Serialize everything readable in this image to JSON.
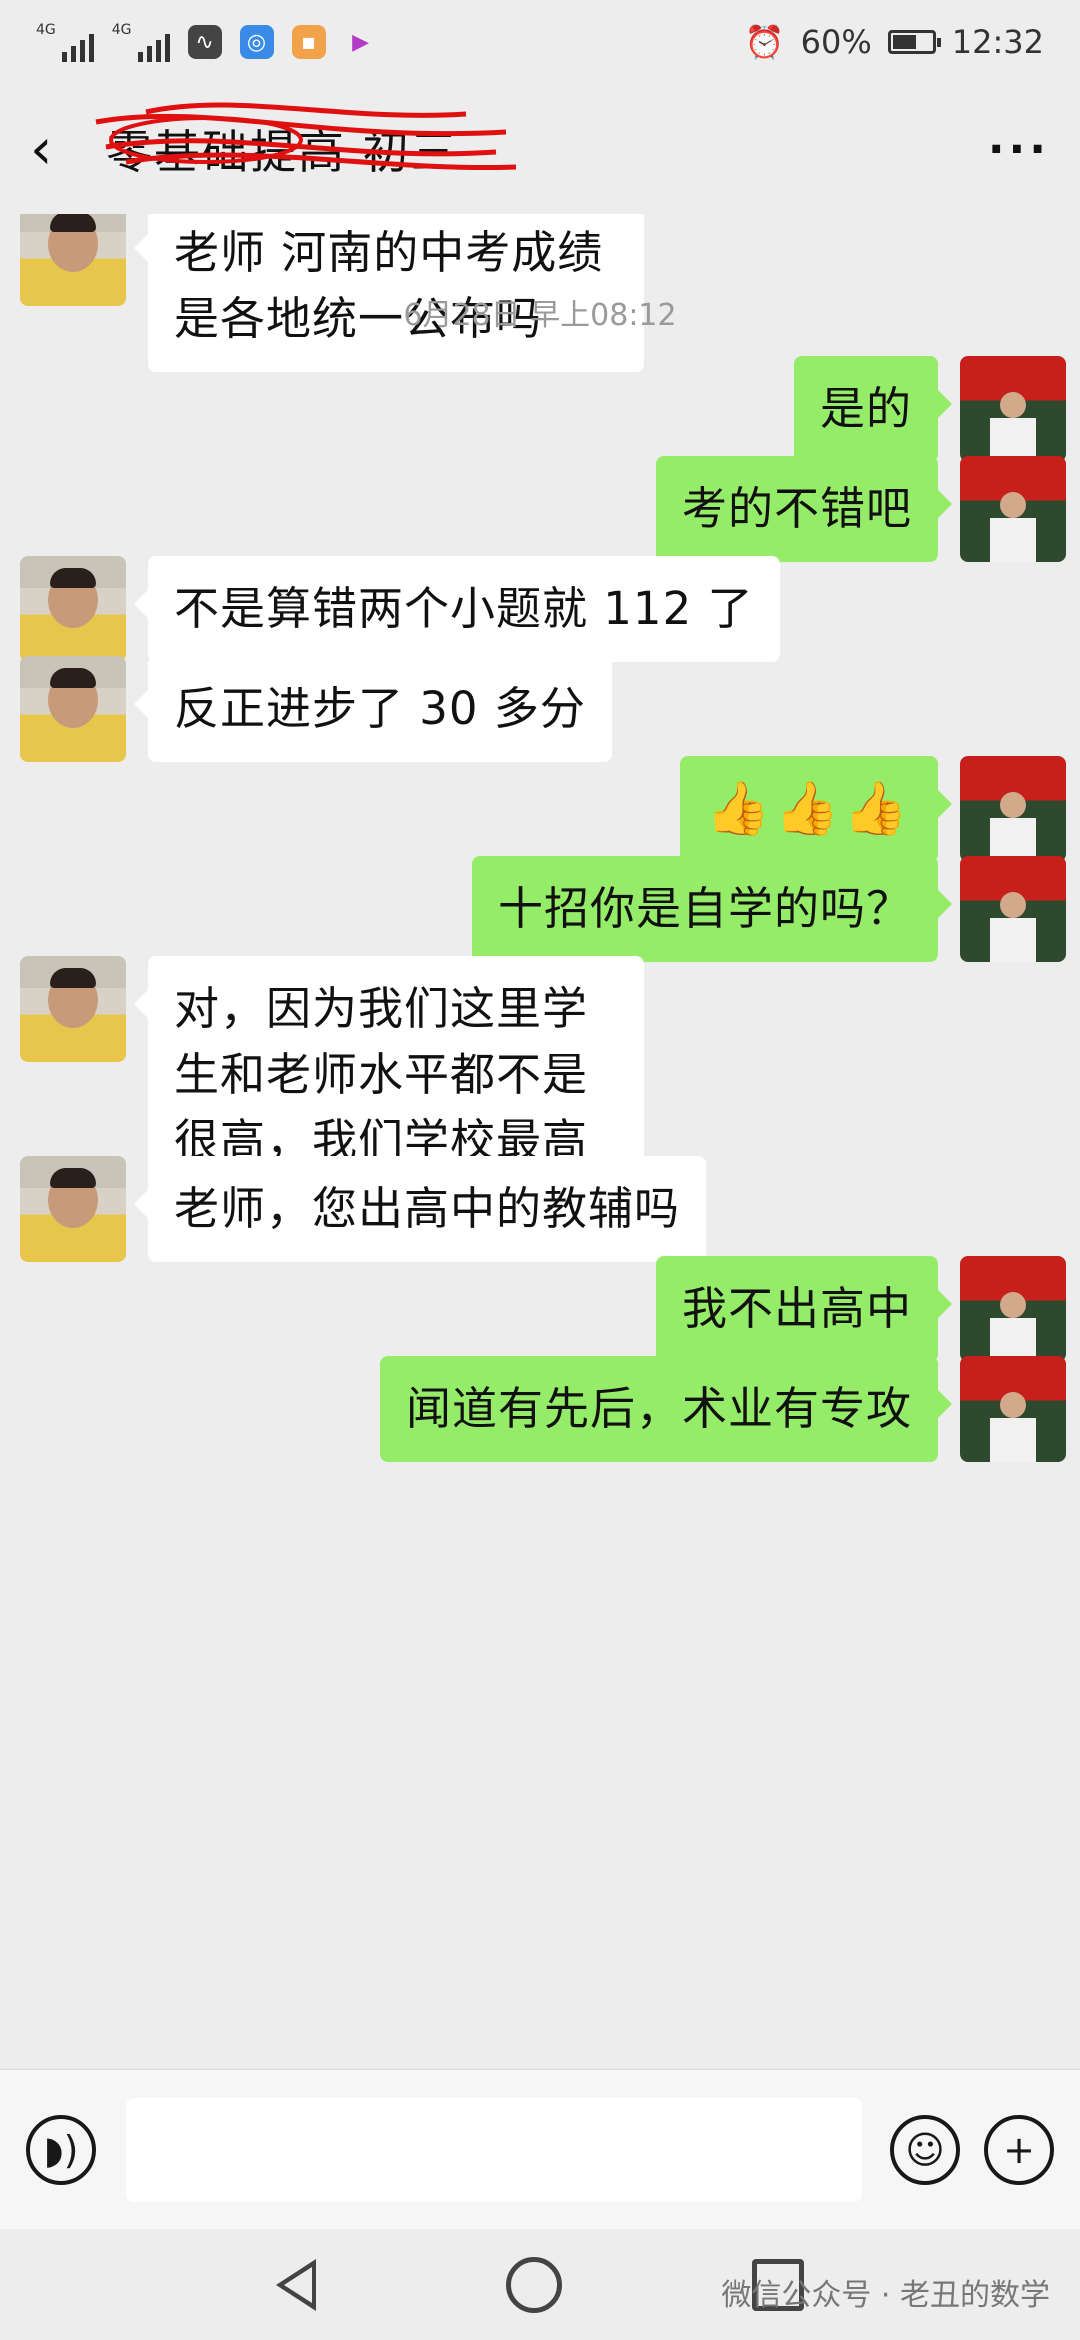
{
  "status_bar": {
    "network1": "4G",
    "network2": "4G",
    "battery_percent": "60%",
    "battery_level": 0.6,
    "time": "12:32",
    "icons": [
      "signal-icon",
      "activity-icon",
      "browser-icon",
      "app-icon",
      "video-icon",
      "alarm-icon",
      "battery-icon"
    ]
  },
  "header": {
    "back_glyph": "‹",
    "title": "零基础提高 初三",
    "more_glyph": "···"
  },
  "messages": [
    {
      "side": "left",
      "text": "老师 河南的中考成绩是各地统一公布吗"
    },
    {
      "side": "timestamp",
      "text": "6月28日 早上08:12"
    },
    {
      "side": "right",
      "text": "是的"
    },
    {
      "side": "right",
      "text": "考的不错吧"
    },
    {
      "side": "left",
      "text": "不是算错两个小题就 112 了"
    },
    {
      "side": "left",
      "text": "反正进步了 30 多分"
    },
    {
      "side": "right",
      "text": "👍👍👍"
    },
    {
      "side": "right",
      "text": "十招你是自学的吗？"
    },
    {
      "side": "left",
      "text": "对，因为我们这里学生和老师水平都不是很高，我们学校最高分才一百零几"
    },
    {
      "side": "left",
      "text": "老师，您出高中的教辅吗"
    },
    {
      "side": "right",
      "text": "我不出高中"
    },
    {
      "side": "right",
      "text": "闻道有先后，术业有专攻"
    }
  ],
  "input_bar": {
    "voice_glyph": "◗)",
    "emoji_glyph": "☺",
    "plus_glyph": "+",
    "input_value": ""
  },
  "watermark": "微信公众号 · 老丑的数学"
}
